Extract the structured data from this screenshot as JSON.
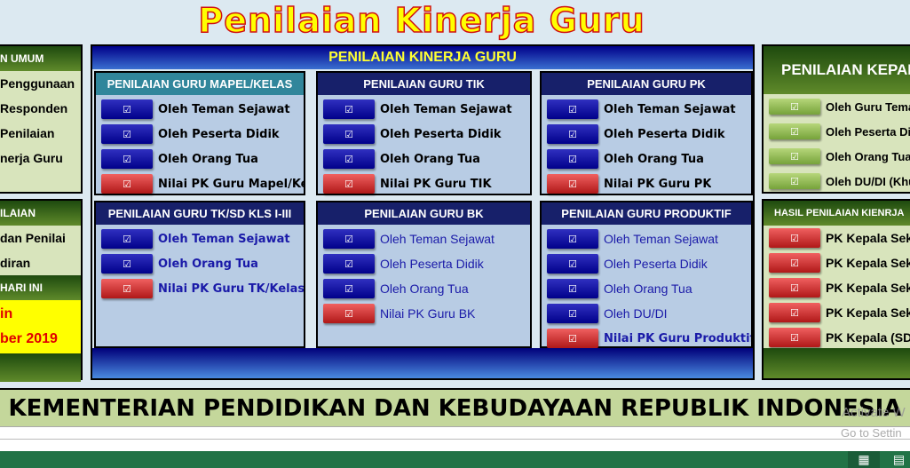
{
  "title": "Penilaian Kinerja Guru",
  "left": {
    "sec1": {
      "header": "N UMUM",
      "items": [
        "Penggunaan",
        "Responden",
        "Penilaian",
        "nerja Guru"
      ]
    },
    "sec2": {
      "header": "ILAIAN",
      "items": [
        "dan Penilai",
        "diran"
      ]
    },
    "sec3": {
      "header": "HARI INI",
      "lines": [
        "in",
        "ber 2019"
      ]
    }
  },
  "center": {
    "header": "PENILAIAN KINERJA GURU",
    "panels": [
      {
        "title": "PENILAIAN GURU MAPEL/KELAS",
        "items": [
          {
            "label": "Oleh Teman Sejawat",
            "btn": "blue"
          },
          {
            "label": "Oleh Peserta Didik",
            "btn": "blue"
          },
          {
            "label": "Oleh Orang Tua",
            "btn": "blue"
          },
          {
            "label": "Nilai PK Guru Mapel/Kelas",
            "btn": "red"
          }
        ]
      },
      {
        "title": "PENILAIAN GURU TIK",
        "items": [
          {
            "label": "Oleh Teman Sejawat",
            "btn": "blue"
          },
          {
            "label": "Oleh Peserta Didik",
            "btn": "blue"
          },
          {
            "label": "Oleh Orang Tua",
            "btn": "blue"
          },
          {
            "label": "Nilai PK Guru TIK",
            "btn": "red"
          }
        ]
      },
      {
        "title": "PENILAIAN GURU PK",
        "items": [
          {
            "label": "Oleh Teman Sejawat",
            "btn": "blue"
          },
          {
            "label": "Oleh Peserta Didik",
            "btn": "blue"
          },
          {
            "label": "Oleh Orang Tua",
            "btn": "blue"
          },
          {
            "label": "Nilai PK Guru PK",
            "btn": "red"
          }
        ]
      },
      {
        "title": "PENILAIAN GURU TK/SD KLS I-III",
        "items": [
          {
            "label": "Oleh Teman Sejawat",
            "btn": "blue"
          },
          {
            "label": "Oleh Orang Tua",
            "btn": "blue"
          },
          {
            "label": "Nilai PK Guru TK/Kelas I-III",
            "btn": "red"
          }
        ]
      },
      {
        "title": "PENILAIAN GURU BK",
        "items": [
          {
            "label": "Oleh Teman Sejawat",
            "btn": "blue"
          },
          {
            "label": "Oleh Peserta Didik",
            "btn": "blue"
          },
          {
            "label": "Oleh Orang Tua",
            "btn": "blue"
          },
          {
            "label": "Nilai PK Guru BK",
            "btn": "red"
          }
        ]
      },
      {
        "title": "PENILAIAN GURU PRODUKTIF",
        "items": [
          {
            "label": "Oleh Teman Sejawat",
            "btn": "blue"
          },
          {
            "label": "Oleh Peserta Didik",
            "btn": "blue"
          },
          {
            "label": "Oleh Orang Tua",
            "btn": "blue"
          },
          {
            "label": "Oleh DU/DI",
            "btn": "blue"
          },
          {
            "label": "Nilai PK Guru Produktif",
            "btn": "red"
          }
        ]
      }
    ]
  },
  "right": {
    "sec1": {
      "header": "PENILAIAN KEPAL",
      "items": [
        "Oleh Guru Teman",
        "Oleh Peserta Didi",
        "Oleh Orang Tua",
        "Oleh DU/DI (Khus"
      ]
    },
    "sec2": {
      "header": "HASIL PENILAIAN KIENRJA",
      "items": [
        "PK Kepala Sekol",
        "PK Kepala Sekol",
        "PK Kepala Sekol",
        "PK Kepala Sekol",
        "PK Kepala (SD/S"
      ]
    }
  },
  "banner": "KEMENTERIAN PENDIDIKAN DAN KEBUDAYAAN REPUBLIK INDONESIA",
  "watermark": [
    "Activate W",
    "Go to Settin"
  ],
  "checkbox_glyph": "☑",
  "colors": {
    "title": "#ffff00",
    "title_outline": "#d01010",
    "panel_blue": "#00008a",
    "panel_green": "#1e4a0e",
    "status_bar": "#217346"
  }
}
